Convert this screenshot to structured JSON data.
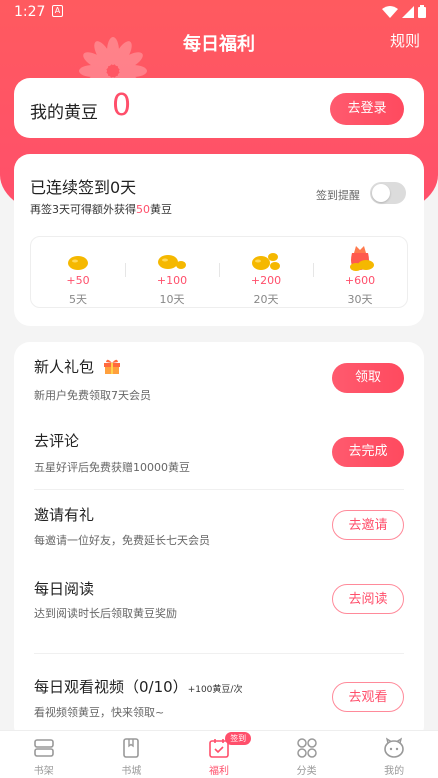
{
  "status_bar": {
    "time": "1:27",
    "notif_letter": "A"
  },
  "header": {
    "title": "每日福利",
    "rules_label": "规则"
  },
  "login": {
    "label": "我的黄豆",
    "bean_count": "0",
    "button_label": "去登录"
  },
  "signin": {
    "title": "已连续签到0天",
    "subtitle_prefix": "再签3天可得额外获得",
    "subtitle_highlight": "50",
    "subtitle_suffix": "黄豆",
    "remind_label": "签到提醒",
    "remind_on": false,
    "rewards": [
      {
        "amount": "+50",
        "day": "5天",
        "icon": "bean-icon"
      },
      {
        "amount": "+100",
        "day": "10天",
        "icon": "beans-icon"
      },
      {
        "amount": "+200",
        "day": "20天",
        "icon": "bean-pile-icon"
      },
      {
        "amount": "+600",
        "day": "30天",
        "icon": "bean-bag-icon"
      }
    ]
  },
  "tasks": [
    {
      "title": "新人礼包",
      "title_extra": "",
      "desc": "新用户免费领取7天会员",
      "button": "领取",
      "style": "solid",
      "icon": "gift-icon"
    },
    {
      "title": "去评论",
      "title_extra": "",
      "desc": "五星好评后免费获赠10000黄豆",
      "button": "去完成",
      "style": "solid"
    },
    {
      "title": "邀请有礼",
      "title_extra": "",
      "desc": "每邀请一位好友，免费延长七天会员",
      "button": "去邀请",
      "style": "outline"
    },
    {
      "title": "每日阅读",
      "title_extra": "",
      "desc": "达到阅读时长后领取黄豆奖励",
      "button": "去阅读",
      "style": "outline"
    },
    {
      "title": "每日观看视频（0/10）",
      "title_extra": "+100黄豆/次",
      "desc": "看视频领黄豆，快来领取~",
      "button": "去观看",
      "style": "outline"
    }
  ],
  "tabbar": {
    "items": [
      {
        "label": "书架",
        "icon": "bookshelf-icon",
        "active": false
      },
      {
        "label": "书城",
        "icon": "bookstore-icon",
        "active": false
      },
      {
        "label": "福利",
        "icon": "calendar-check-icon",
        "active": true,
        "badge": "签到"
      },
      {
        "label": "分类",
        "icon": "category-grid-icon",
        "active": false
      },
      {
        "label": "我的",
        "icon": "profile-face-icon",
        "active": false
      }
    ]
  },
  "colors": {
    "primary": "#ff4f6b",
    "header_gradient_top": "#ff5a5f",
    "bean": "#f5b800"
  }
}
